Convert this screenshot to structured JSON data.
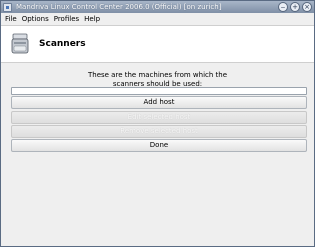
{
  "window": {
    "title": "Mandriva Linux Control Center 2006.0 (Official) [on zurich]",
    "controls": [
      "‒",
      "+",
      "×"
    ]
  },
  "menubar": {
    "items": [
      "File",
      "Options",
      "Profiles",
      "Help"
    ]
  },
  "header": {
    "title": "Scanners",
    "icon": "scanner-icon"
  },
  "content": {
    "description_line1": "These are the machines from which the",
    "description_line2": "scanners should be used:",
    "hosts_list": [],
    "buttons": {
      "add_host": "Add host",
      "edit_host": "Edit selected host",
      "remove_host": "Remove selected host",
      "done": "Done"
    }
  },
  "colors": {
    "titlebar": "#8fa0b6",
    "window_bg": "#efefef",
    "header_bg": "#ffffff"
  }
}
